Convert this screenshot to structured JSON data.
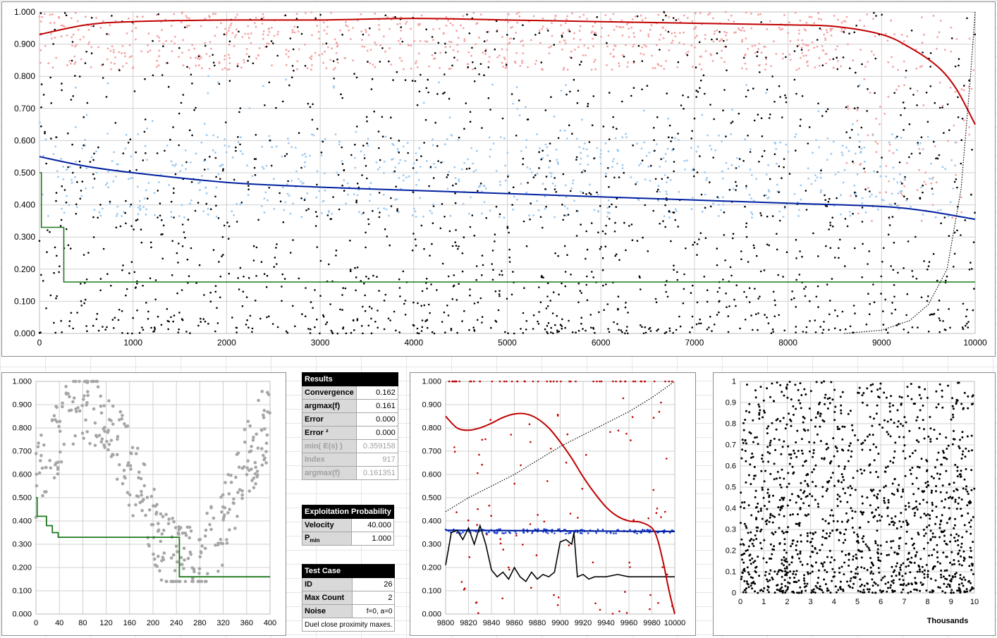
{
  "colors": {
    "red_points": "#f4a3a3",
    "red_curve": "#c00000",
    "blue_points": "#9dc9f0",
    "blue_curve": "#0020a0",
    "black_points": "#000000",
    "green_line": "#1a7a1a",
    "gray_points": "#a6a6a6"
  },
  "chart_data": [
    {
      "type": "scatter",
      "name": "main-run",
      "xlim": [
        0,
        10000
      ],
      "ylim": [
        0,
        1
      ],
      "xticks": [
        "0",
        "1000",
        "2000",
        "3000",
        "4000",
        "5000",
        "6000",
        "7000",
        "8000",
        "9000",
        "10000"
      ],
      "yticks": [
        "0.000",
        "0.100",
        "0.200",
        "0.300",
        "0.400",
        "0.500",
        "0.600",
        "0.700",
        "0.800",
        "0.900",
        "1.000"
      ],
      "grid": true,
      "red_curve": {
        "x": [
          0,
          500,
          1000,
          2000,
          3000,
          4000,
          5000,
          6000,
          7000,
          8000,
          8500,
          9000,
          9300,
          9600,
          9800,
          10000
        ],
        "y": [
          0.93,
          0.96,
          0.97,
          0.975,
          0.975,
          0.98,
          0.975,
          0.97,
          0.965,
          0.96,
          0.955,
          0.93,
          0.89,
          0.83,
          0.76,
          0.65
        ]
      },
      "blue_curve": {
        "x": [
          0,
          500,
          1000,
          2000,
          3000,
          4000,
          5000,
          6000,
          7000,
          8000,
          9000,
          9500,
          10000
        ],
        "y": [
          0.55,
          0.52,
          0.5,
          0.47,
          0.455,
          0.445,
          0.435,
          0.425,
          0.415,
          0.405,
          0.395,
          0.38,
          0.355
        ]
      },
      "green_step": {
        "x": [
          0,
          20,
          20,
          260,
          260,
          10000
        ],
        "y": [
          0.5,
          0.5,
          0.33,
          0.33,
          0.16,
          0.16
        ]
      },
      "black_dotted": {
        "x": [
          8600,
          9000,
          9300,
          9500,
          9700,
          9850,
          9950,
          10000
        ],
        "y": [
          0.0,
          0.01,
          0.04,
          0.09,
          0.2,
          0.45,
          0.8,
          1.0
        ]
      }
    },
    {
      "type": "scatter",
      "name": "zoom-start",
      "xlim": [
        0,
        400
      ],
      "ylim": [
        0,
        1
      ],
      "xticks": [
        "0",
        "40",
        "80",
        "120",
        "160",
        "200",
        "240",
        "280",
        "320",
        "360",
        "400"
      ],
      "yticks": [
        "0.000",
        "0.100",
        "0.200",
        "0.300",
        "0.400",
        "0.500",
        "0.600",
        "0.700",
        "0.800",
        "0.900",
        "1.000"
      ],
      "grid": true,
      "green_step": {
        "x": [
          0,
          2,
          2,
          18,
          18,
          28,
          28,
          38,
          38,
          245,
          245,
          400
        ],
        "y": [
          0.5,
          0.5,
          0.42,
          0.42,
          0.38,
          0.38,
          0.35,
          0.35,
          0.33,
          0.33,
          0.16,
          0.16
        ]
      }
    },
    {
      "type": "line",
      "name": "zoom-end",
      "xlim": [
        9800,
        10000
      ],
      "ylim": [
        0,
        1
      ],
      "xticks": [
        "9800",
        "9820",
        "9840",
        "9860",
        "9880",
        "9900",
        "9920",
        "9940",
        "9960",
        "9980",
        "10000"
      ],
      "yticks": [
        "0.000",
        "0.100",
        "0.200",
        "0.300",
        "0.400",
        "0.500",
        "0.600",
        "0.700",
        "0.800",
        "0.900",
        "1.000"
      ],
      "grid": true,
      "red_curve": {
        "x": [
          9800,
          9810,
          9820,
          9830,
          9840,
          9850,
          9860,
          9870,
          9880,
          9890,
          9900,
          9910,
          9920,
          9930,
          9940,
          9950,
          9960,
          9970,
          9980,
          9985,
          9990,
          9995,
          10000
        ],
        "y": [
          0.85,
          0.8,
          0.79,
          0.8,
          0.82,
          0.845,
          0.86,
          0.86,
          0.84,
          0.8,
          0.74,
          0.67,
          0.59,
          0.52,
          0.46,
          0.42,
          0.4,
          0.395,
          0.37,
          0.32,
          0.22,
          0.1,
          0.0
        ]
      },
      "blue_line": {
        "x": [
          9800,
          10000
        ],
        "y": [
          0.36,
          0.355
        ]
      },
      "black_dotted": {
        "x": [
          9800,
          9820,
          9840,
          9860,
          9880,
          9900,
          9920,
          9940,
          9960,
          9980,
          10000
        ],
        "y": [
          0.44,
          0.5,
          0.55,
          0.6,
          0.66,
          0.72,
          0.77,
          0.82,
          0.87,
          0.93,
          1.0
        ]
      },
      "black_line": {
        "x": [
          9800,
          9805,
          9810,
          9815,
          9820,
          9825,
          9830,
          9835,
          9840,
          9845,
          9850,
          9855,
          9860,
          9865,
          9870,
          9875,
          9880,
          9885,
          9890,
          9895,
          9900,
          9905,
          9910,
          9912,
          9915,
          9920,
          9925,
          9930,
          9940,
          9950,
          9960,
          9970,
          9980,
          9990,
          10000
        ],
        "y": [
          0.21,
          0.35,
          0.36,
          0.32,
          0.37,
          0.3,
          0.38,
          0.3,
          0.19,
          0.16,
          0.18,
          0.15,
          0.2,
          0.16,
          0.14,
          0.18,
          0.15,
          0.17,
          0.16,
          0.18,
          0.31,
          0.32,
          0.3,
          0.35,
          0.16,
          0.17,
          0.15,
          0.16,
          0.16,
          0.17,
          0.16,
          0.16,
          0.16,
          0.16,
          0.16
        ]
      }
    },
    {
      "type": "scatter",
      "name": "overview-thousands",
      "xlim": [
        0,
        10
      ],
      "ylim": [
        0,
        1
      ],
      "xticks": [
        "0",
        "1",
        "2",
        "3",
        "4",
        "5",
        "6",
        "7",
        "8",
        "9",
        "10"
      ],
      "yticks": [
        "0",
        "0.1",
        "0.2",
        "0.3",
        "0.4",
        "0.5",
        "0.6",
        "0.7",
        "0.8",
        "0.9",
        "1"
      ],
      "xlabel": "Thousands",
      "grid": true
    }
  ],
  "results": {
    "title": "Results",
    "rows": [
      {
        "label": "Convergence",
        "value": "0.162"
      },
      {
        "label": "argmax(f)",
        "value": "0.161"
      },
      {
        "label": "Error",
        "value": "0.000"
      },
      {
        "label": "Error ²",
        "value": "0.000"
      },
      {
        "label": "min( E(s) )",
        "value": "0.359158"
      },
      {
        "label": "Index",
        "value": "917"
      },
      {
        "label": "argmax(f)",
        "value": "0.161351"
      }
    ]
  },
  "exploitation": {
    "title": "Exploitation Probability",
    "rows": [
      {
        "label": "Velocity",
        "value": "40.000"
      },
      {
        "label": "P",
        "sub": "min",
        "value": "1.000"
      }
    ]
  },
  "test_case": {
    "title": "Test Case",
    "rows": [
      {
        "label": "ID",
        "value": "26"
      },
      {
        "label": "Max Count",
        "value": "2"
      },
      {
        "label": "Noise",
        "value": "f=0, a=0"
      }
    ],
    "note": "Duel close proximity maxes."
  }
}
